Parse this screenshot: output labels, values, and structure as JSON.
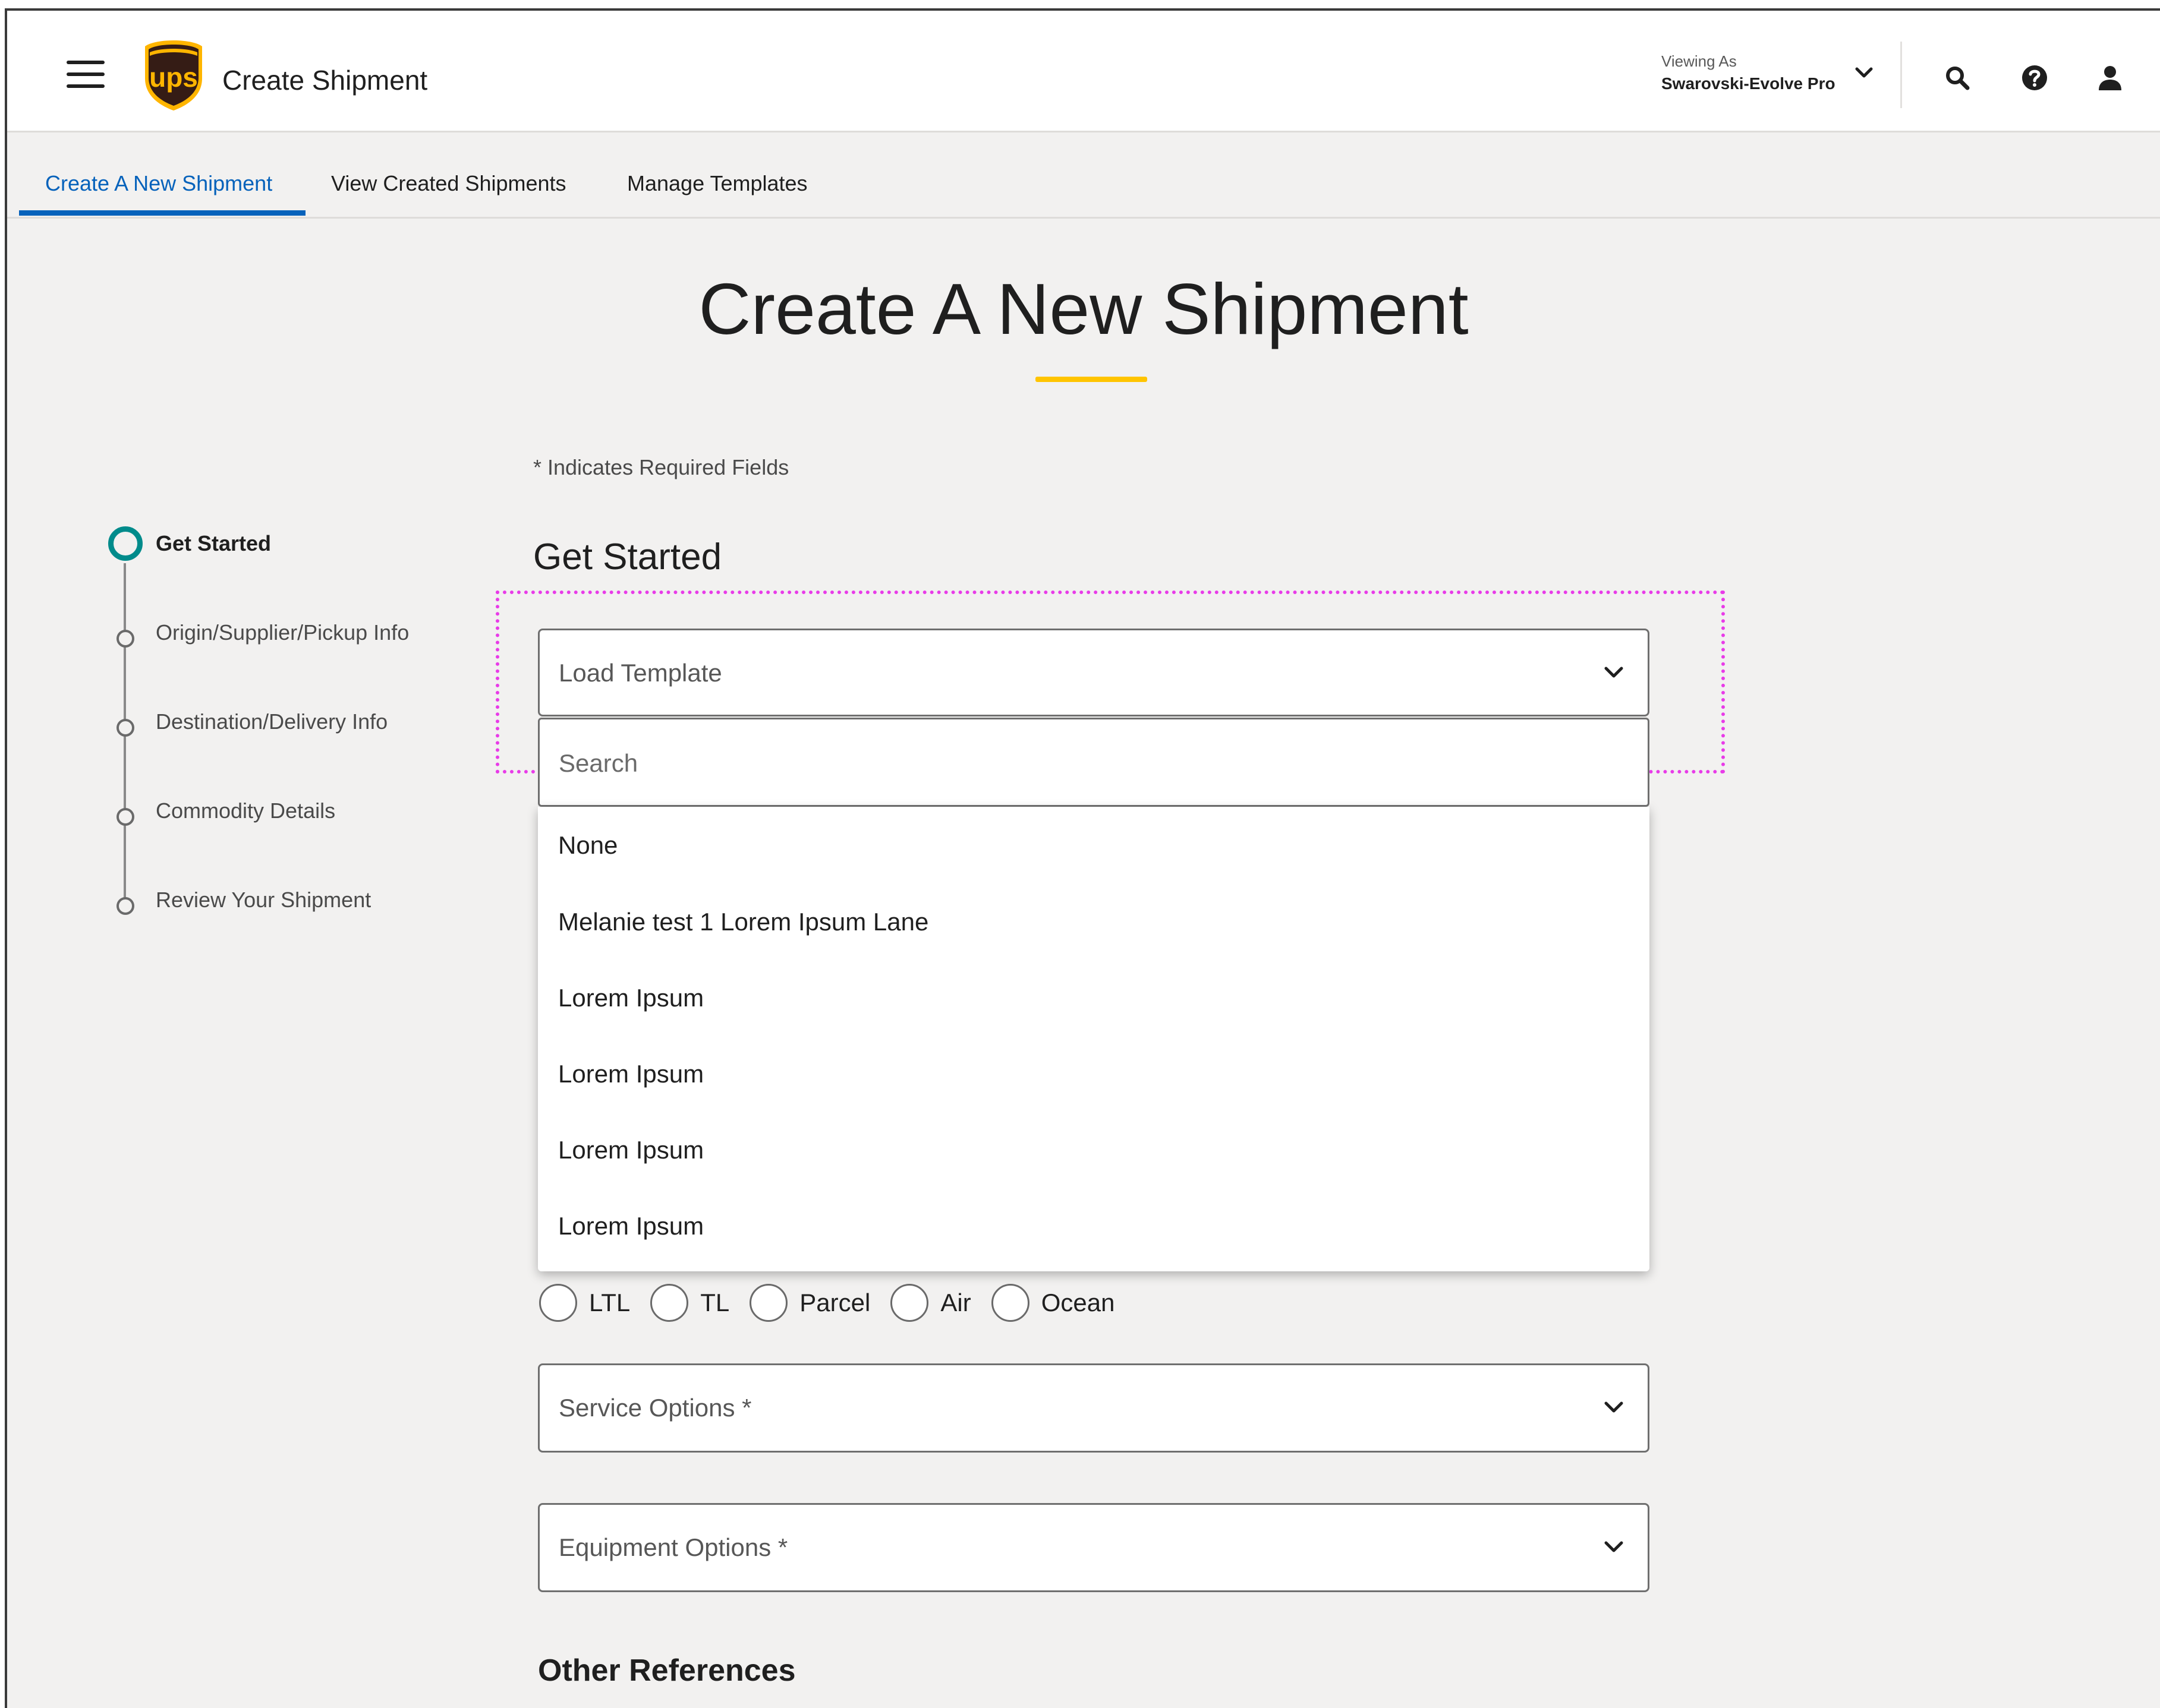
{
  "header": {
    "app_title": "Create Shipment",
    "viewing_label": "Viewing As",
    "viewing_name": "Swarovski-Evolve Pro",
    "logo_text": "ups"
  },
  "tabs": [
    {
      "label": "Create A New Shipment",
      "active": true
    },
    {
      "label": "View Created Shipments",
      "active": false
    },
    {
      "label": "Manage Templates",
      "active": false
    }
  ],
  "page": {
    "title": "Create A New Shipment",
    "required_note": "* Indicates Required Fields",
    "section_title": "Get Started",
    "other_references": "Other References"
  },
  "stepper": [
    {
      "label": "Get Started",
      "current": true
    },
    {
      "label": "Origin/Supplier/Pickup Info",
      "current": false
    },
    {
      "label": "Destination/Delivery Info",
      "current": false
    },
    {
      "label": "Commodity Details",
      "current": false
    },
    {
      "label": "Review Your Shipment",
      "current": false
    }
  ],
  "load_template": {
    "placeholder": "Load Template",
    "search_placeholder": "Search",
    "options": [
      "None",
      "Melanie test 1 Lorem Ipsum Lane",
      "Lorem Ipsum",
      "Lorem Ipsum",
      "Lorem Ipsum",
      "Lorem Ipsum"
    ]
  },
  "modes": [
    "LTL",
    "TL",
    "Parcel",
    "Air",
    "Ocean"
  ],
  "service_options": {
    "placeholder": "Service Options *"
  },
  "equipment_options": {
    "placeholder": "Equipment Options *"
  },
  "colors": {
    "accent": "#0662bb",
    "brand_gold": "#ffc400",
    "brand_brown": "#351c15",
    "stepper_active": "#008b8b",
    "highlight": "#e83be8"
  },
  "icons": [
    "hamburger-icon",
    "ups-logo",
    "chevron-down-icon",
    "search-icon",
    "help-icon",
    "user-icon"
  ]
}
